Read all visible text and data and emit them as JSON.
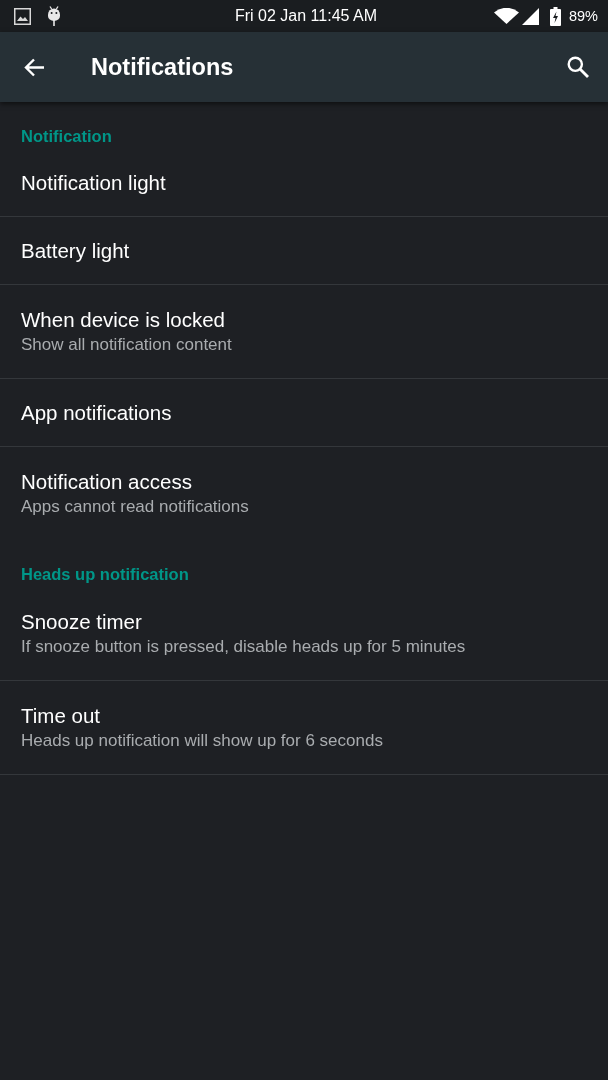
{
  "status_bar": {
    "time": "Fri 02 Jan 11:45 AM",
    "battery": "89%"
  },
  "toolbar": {
    "title": "Notifications"
  },
  "categories": [
    {
      "title": "Notification",
      "items": [
        {
          "title": "Notification light"
        },
        {
          "title": "Battery light"
        },
        {
          "title": "When device is locked",
          "summary": "Show all notification content"
        },
        {
          "title": "App notifications"
        },
        {
          "title": "Notification access",
          "summary": "Apps cannot read notifications"
        }
      ]
    },
    {
      "title": "Heads up notification",
      "items": [
        {
          "title": "Snooze timer",
          "summary": "If snooze button is pressed, disable heads up for 5 minutes"
        },
        {
          "title": "Time out",
          "summary": "Heads up notification will show up for 6 seconds"
        }
      ]
    }
  ]
}
